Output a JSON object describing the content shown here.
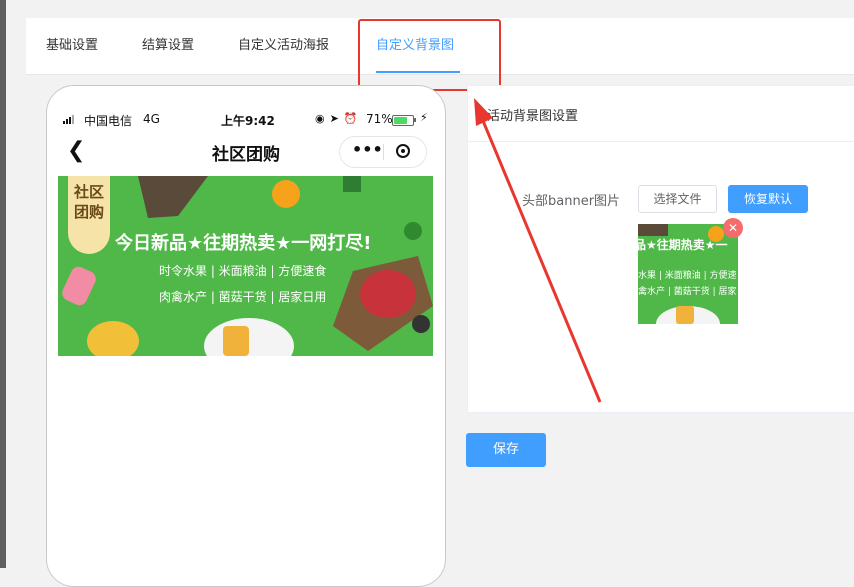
{
  "tabs": [
    {
      "label": "基础设置",
      "active": false
    },
    {
      "label": "结算设置",
      "active": false
    },
    {
      "label": "自定义活动海报",
      "active": false
    },
    {
      "label": "自定义背景图",
      "active": true
    }
  ],
  "phone": {
    "status": {
      "carrier": "中国电信",
      "network": "4G",
      "time": "上午9:42",
      "battery": "71%",
      "battery_level": 0.71
    },
    "nav_title": "社区团购",
    "banner": {
      "tag": "社区团购",
      "headline": "今日新品★往期热卖★一网打尽!",
      "line1": "时令水果 | 米面粮油 | 方便速食",
      "line2": "肉禽水产 | 菌菇干货 | 居家日用"
    }
  },
  "panel": {
    "title": "活动背景图设置",
    "field_label": "头部banner图片",
    "choose_file": "选择文件",
    "restore_default": "恢复默认",
    "thumb": {
      "line1": "品★往期热卖★一",
      "line2": "水果 | 米面粮油 | 方便速",
      "line3": "禽水产 | 菌菇干货 | 居家日"
    }
  },
  "save_label": "保存",
  "colors": {
    "primary": "#409eff",
    "annotation_red": "#e8372f",
    "banner_green": "#4fb848"
  }
}
